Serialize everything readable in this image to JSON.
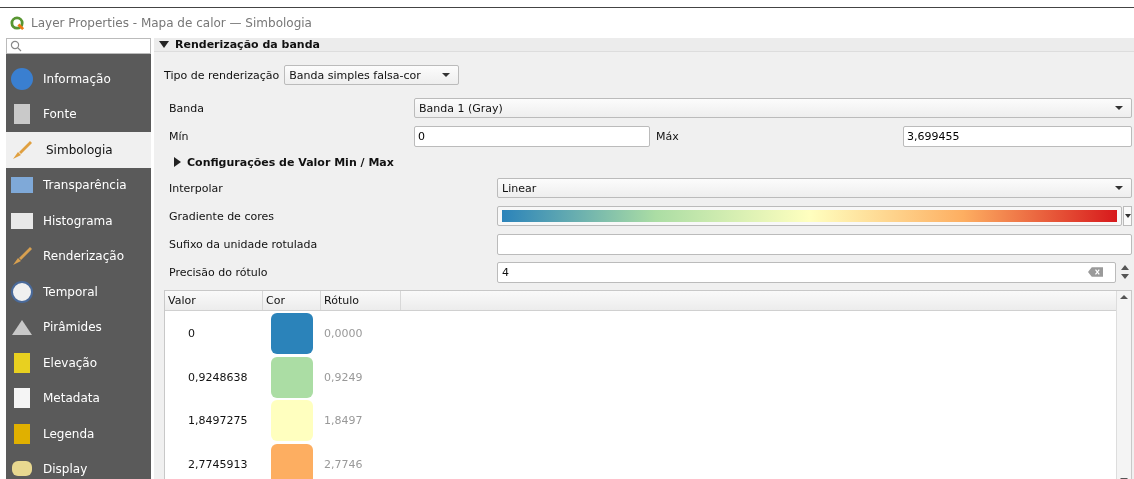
{
  "window": {
    "title": "Layer Properties - Mapa de calor — Simbologia"
  },
  "sidebar": {
    "items": [
      {
        "label": "Informação",
        "selected": false
      },
      {
        "label": "Fonte",
        "selected": false
      },
      {
        "label": "Simbologia",
        "selected": true
      },
      {
        "label": "Transparência",
        "selected": false
      },
      {
        "label": "Histograma",
        "selected": false
      },
      {
        "label": "Renderização",
        "selected": false
      },
      {
        "label": "Temporal",
        "selected": false
      },
      {
        "label": "Pirâmides",
        "selected": false
      },
      {
        "label": "Elevação",
        "selected": false
      },
      {
        "label": "Metadata",
        "selected": false
      },
      {
        "label": "Legenda",
        "selected": false
      },
      {
        "label": "Display",
        "selected": false
      }
    ]
  },
  "section": {
    "title": "Renderização da banda",
    "expanded": true
  },
  "render_type": {
    "label": "Tipo de renderização",
    "value": "Banda simples falsa-cor"
  },
  "band": {
    "label": "Banda",
    "value": "Banda 1 (Gray)"
  },
  "min": {
    "label": "Mín",
    "value": "0"
  },
  "max": {
    "label": "Máx",
    "value": "3,699455"
  },
  "minmax_settings": {
    "title": "Configurações de Valor Min / Max",
    "expanded": false
  },
  "interpolation": {
    "label": "Interpolar",
    "value": "Linear"
  },
  "color_ramp": {
    "label": "Gradiente de cores"
  },
  "unit_suffix": {
    "label": "Sufixo da unidade rotulada"
  },
  "label_precision": {
    "label": "Precisão do rótulo",
    "value": "4"
  },
  "table": {
    "columns": [
      "Valor",
      "Cor",
      "Rótulo"
    ],
    "rows": [
      {
        "value": "0",
        "color": "#2b83ba",
        "label": "0,0000"
      },
      {
        "value": "0,9248638",
        "color": "#abdda4",
        "label": "0,9249"
      },
      {
        "value": "1,8497275",
        "color": "#ffffbf",
        "label": "1,8497"
      },
      {
        "value": "2,7745913",
        "color": "#fdae61",
        "label": "2,7746"
      }
    ]
  }
}
